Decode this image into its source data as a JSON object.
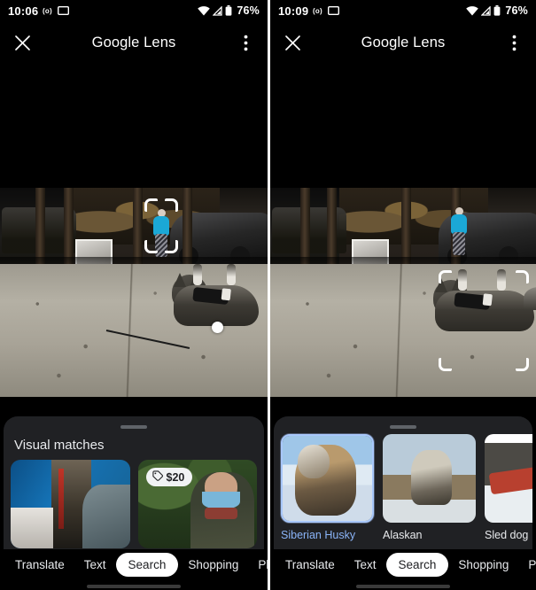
{
  "screens": [
    {
      "id": "left",
      "status": {
        "time": "10:06",
        "cast_icon": "cast-icon",
        "screen_icon": "screen-cast-icon",
        "wifi_icon": "wifi-icon",
        "signal_icon": "cell-signal-icon",
        "battery_icon": "battery-icon",
        "battery_percent": "76%"
      },
      "appbar": {
        "close_icon": "close-icon",
        "title": "Google Lens",
        "overflow_icon": "more-vertical-icon"
      },
      "viewfinder": {
        "selection_target": "cyclist",
        "reticle_icon": "focus-reticle-icon",
        "handle_icon": "drag-handle-dot-icon"
      },
      "sheet": {
        "grabber_icon": "drag-grabber-icon",
        "title": "Visual matches",
        "cards": [
          {
            "name": "visual-match-card-1",
            "badge": null,
            "badge_icon": null
          },
          {
            "name": "visual-match-card-2",
            "badge": "$20",
            "badge_icon": "price-tag-icon"
          }
        ]
      },
      "tabs": [
        {
          "label": "Translate",
          "active": false
        },
        {
          "label": "Text",
          "active": false
        },
        {
          "label": "Search",
          "active": true
        },
        {
          "label": "Shopping",
          "active": false
        },
        {
          "label": "Places",
          "active": false
        }
      ]
    },
    {
      "id": "right",
      "status": {
        "time": "10:09",
        "cast_icon": "cast-icon",
        "screen_icon": "screen-cast-icon",
        "wifi_icon": "wifi-icon",
        "signal_icon": "cell-signal-icon",
        "battery_icon": "battery-icon",
        "battery_percent": "76%"
      },
      "appbar": {
        "close_icon": "close-icon",
        "title": "Google Lens",
        "overflow_icon": "more-vertical-icon"
      },
      "viewfinder": {
        "selection_target": "husky-dog",
        "reticle_icon": "focus-reticle-icon"
      },
      "sheet": {
        "grabber_icon": "drag-grabber-icon",
        "results": [
          {
            "label": "Siberian Husky",
            "selected": true
          },
          {
            "label": "Alaskan",
            "selected": false
          },
          {
            "label": "Sled dog",
            "selected": false
          }
        ]
      },
      "tabs": [
        {
          "label": "Translate",
          "active": false
        },
        {
          "label": "Text",
          "active": false
        },
        {
          "label": "Search",
          "active": true
        },
        {
          "label": "Shopping",
          "active": false
        },
        {
          "label": "Places",
          "active": false
        }
      ]
    }
  ],
  "colors": {
    "sheet_bg": "#202124",
    "accent_blue": "#8ab4f8",
    "selected_border": "#a8c7fa",
    "active_tab_bg": "#ffffff",
    "text_primary": "#e8eaed",
    "screen_bg": "#000000"
  }
}
